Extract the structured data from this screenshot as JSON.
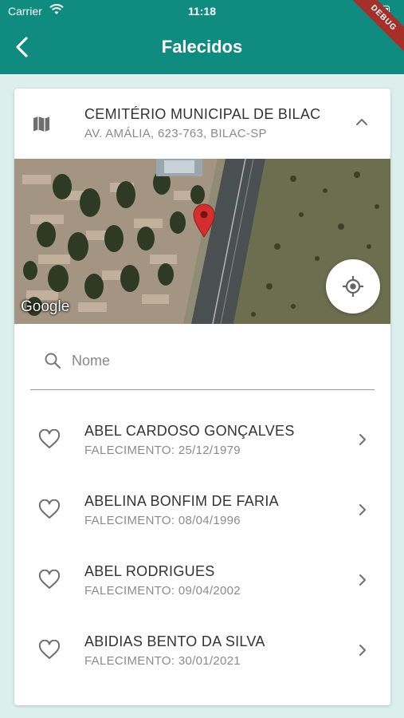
{
  "status_bar": {
    "carrier": "Carrier",
    "time": "11:18",
    "debug": "DEBUG"
  },
  "app_bar": {
    "title": "Falecidos"
  },
  "cemetery": {
    "name": "CEMITÉRIO MUNICIPAL DE BILAC",
    "address": "AV. AMÁLIA, 623-763, BILAC-SP"
  },
  "map": {
    "attribution": "Google"
  },
  "search": {
    "placeholder": "Nome",
    "value": ""
  },
  "deceased": [
    {
      "name": "ABEL CARDOSO GONÇALVES",
      "date_label": "FALECIMENTO: 25/12/1979"
    },
    {
      "name": "ABELINA BONFIM DE FARIA",
      "date_label": "FALECIMENTO: 08/04/1996"
    },
    {
      "name": "ABEL RODRIGUES",
      "date_label": "FALECIMENTO: 09/04/2002"
    },
    {
      "name": "ABIDIAS BENTO DA SILVA",
      "date_label": "FALECIMENTO: 30/01/2021"
    }
  ],
  "colors": {
    "primary": "#0f8b80",
    "background": "#dcefec",
    "pin": "#d32f2f"
  }
}
